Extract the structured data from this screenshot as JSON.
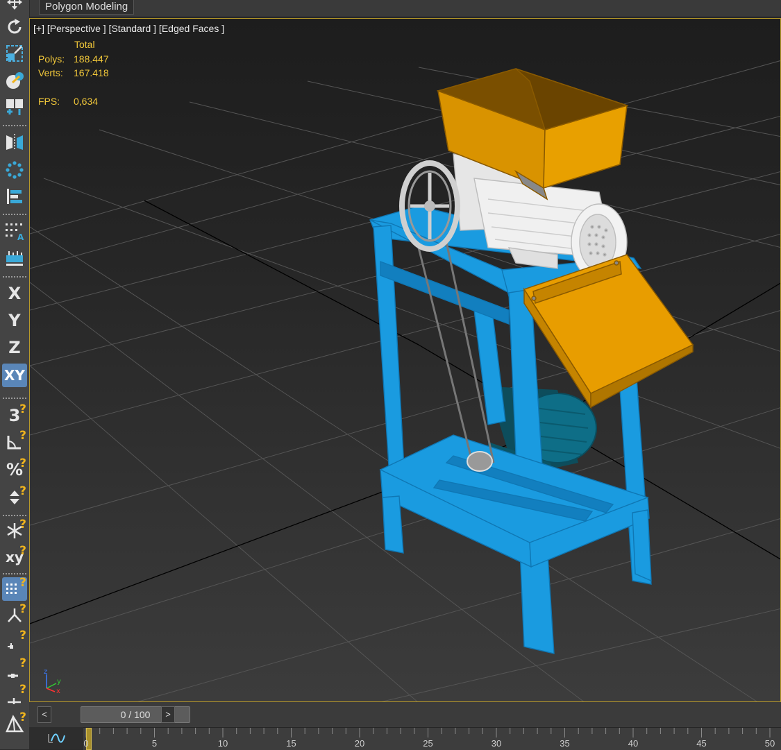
{
  "ribbon": {
    "tab_label": "Polygon Modeling"
  },
  "viewport": {
    "label": "[+] [Perspective ] [Standard ] [Edged Faces ]",
    "stats": {
      "header": "Total",
      "polys_label": "Polys:",
      "polys_value": "188.447",
      "verts_label": "Verts:",
      "verts_value": "167.418",
      "fps_label": "FPS:",
      "fps_value": "0,634"
    },
    "axis_labels": {
      "z": "z",
      "y": "y",
      "x": "x"
    },
    "model_colors": {
      "frame": "#1a9be0",
      "hopper": "#e8a000",
      "grinder": "#e8e8e8",
      "motor": "#0e6e87",
      "grid": "#525252"
    }
  },
  "toolbar": {
    "x_label": "X",
    "y_label": "Y",
    "z_label": "Z",
    "xy_label": "XY",
    "snap3_label": "3",
    "percent_label": "%",
    "xy_small_label": "xy",
    "icons": [
      "move-icon",
      "rotate-icon",
      "scale-icon",
      "place-icon",
      "link-icon",
      "mirror-icon",
      "array-icon",
      "align-icon",
      "select-region-icon",
      "measure-icon",
      "angle-snap-icon",
      "spinner-snap-icon",
      "freeze-icon",
      "grid-snap-icon",
      "pivot-icon",
      "vertex-snap-icon",
      "edge-snap-icon",
      "face-snap-icon",
      "polygon-snap-icon"
    ]
  },
  "timeline": {
    "prev": "<",
    "next": ">",
    "frame_display": "0 / 100",
    "ruler_labels": [
      "0",
      "5",
      "10",
      "15",
      "20",
      "25",
      "30",
      "35",
      "40",
      "45",
      "50"
    ],
    "current_frame": 0,
    "accent": "#a8902c"
  }
}
